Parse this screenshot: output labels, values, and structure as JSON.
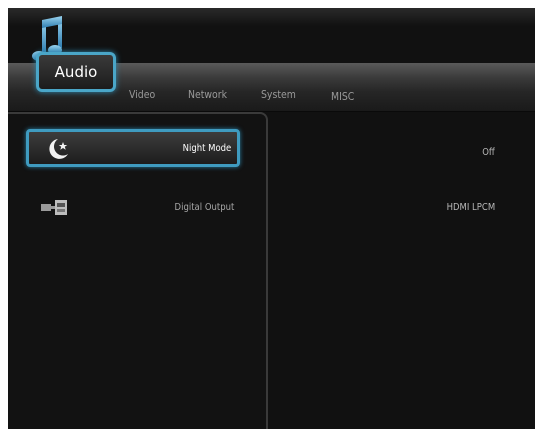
{
  "tabs": [
    {
      "label": "Audio",
      "active": true
    },
    {
      "label": "Video"
    },
    {
      "label": "Network"
    },
    {
      "label": "System"
    },
    {
      "label": "MISC"
    }
  ],
  "settings": [
    {
      "label": "Night Mode",
      "value": "Off",
      "icon": "moon-star-icon",
      "selected": true
    },
    {
      "label": "Digital Output",
      "value": "HDMI LPCM",
      "icon": "digital-output-icon",
      "selected": false
    }
  ],
  "colors": {
    "accent": "#3f9bc0",
    "background": "#111111",
    "text": "#ffffff",
    "text_dim": "#a8a8a8"
  }
}
